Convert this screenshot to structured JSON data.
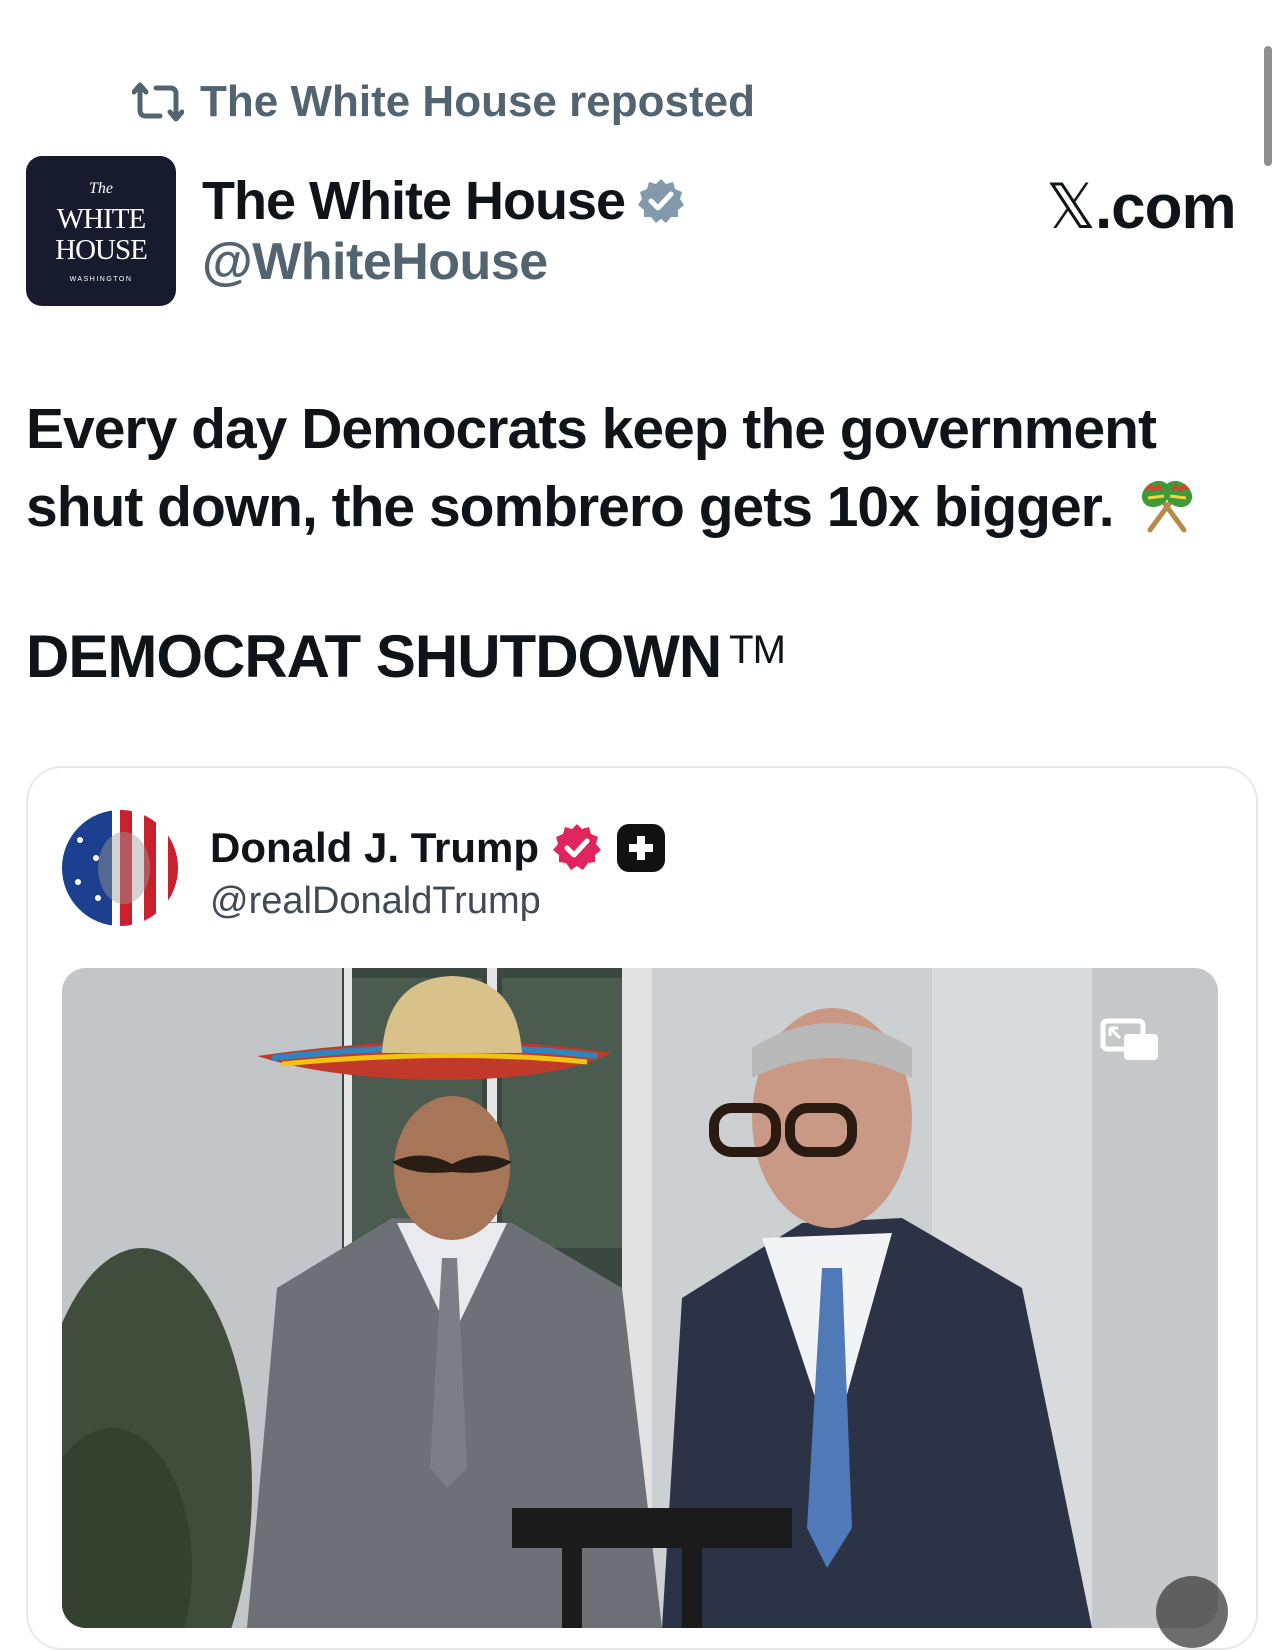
{
  "repost_label": "The White House reposted",
  "author": {
    "name": "The White House",
    "handle": "@WhiteHouse",
    "avatar_text": {
      "top": "The",
      "line1": "WHITE",
      "line2": "HOUSE",
      "bottom": "WASHINGTON"
    }
  },
  "brand": {
    "mark": "𝕏",
    "suffix": ".com"
  },
  "post": {
    "text": "Every day Democrats keep the government shut down, the sombrero gets 10x bigger.",
    "title": "DEMOCRAT SHUTDOWN",
    "title_mark": "TM"
  },
  "quoted": {
    "name": "Donald J. Trump",
    "handle": "@realDonaldTrump"
  },
  "colors": {
    "verified_gray": "#829aab",
    "verified_red": "#e0245e",
    "secondary_text": "#536471",
    "avatar_bg": "#181b2e"
  },
  "icons": [
    "repost-icon",
    "verified-badge-icon",
    "maracas-emoji-icon",
    "verified-red-badge-icon",
    "plus-badge-icon",
    "picture-in-picture-icon",
    "mute-icon"
  ]
}
